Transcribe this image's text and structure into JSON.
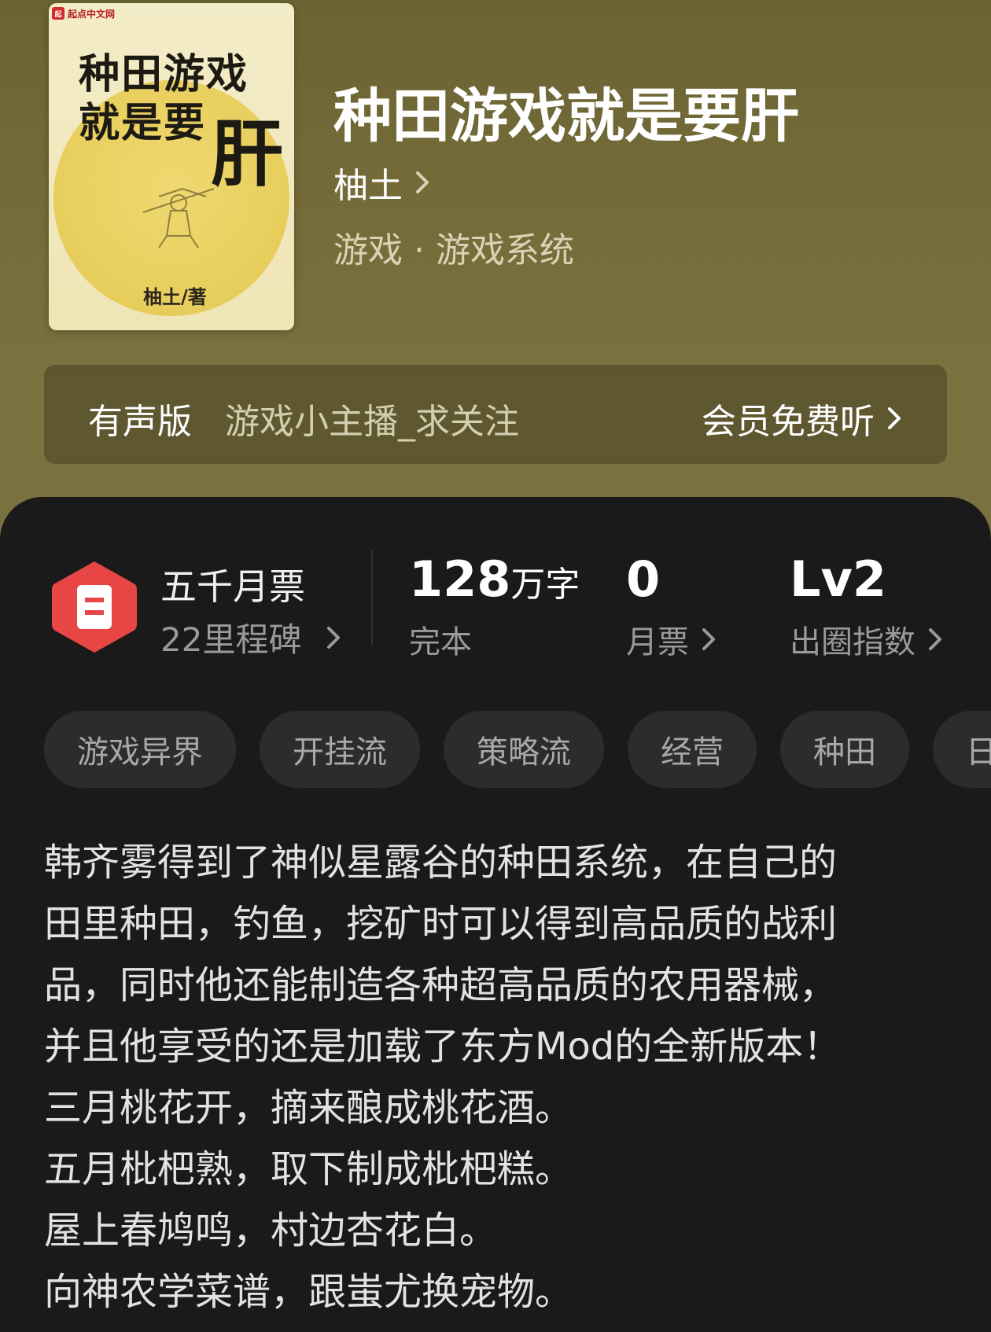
{
  "book": {
    "cover": {
      "publisher_logo": "起点中文网",
      "title_line1": "种田游戏",
      "title_line2": "就是要",
      "title_big": "肝",
      "author_credit": "柚土/著"
    },
    "title": "种田游戏就是要肝",
    "author": "柚土",
    "genre": "游戏 · 游戏系统"
  },
  "audio": {
    "label": "有声版",
    "narrator": "游戏小主播_求关注",
    "cta": "会员免费听"
  },
  "stats": {
    "badge_title": "五千月票",
    "badge_sub": "22里程碑",
    "words_value": "128",
    "words_unit": "万字",
    "words_label": "完本",
    "tickets_value": "0",
    "tickets_label": "月票",
    "circle_value": "Lv2",
    "circle_label": "出圈指数"
  },
  "tags": [
    "游戏异界",
    "开挂流",
    "策略流",
    "经营",
    "种田",
    "日"
  ],
  "description": [
    "韩齐雾得到了神似星露谷的种田系统，在自己的",
    "田里种田，钓鱼，挖矿时可以得到高品质的战利",
    "品，同时他还能制造各种超高品质的农用器械，",
    "并且他享受的还是加载了东方Mod的全新版本！",
    "三月桃花开，摘来酿成桃花酒。",
    "五月枇杷熟，取下制成枇杷糕。",
    "屋上春鸠鸣，村边杏花白。",
    "向神农学菜谱，跟蚩尤换宠物。"
  ],
  "colors": {
    "hero_bg": "#746b38",
    "panel_bg": "#1a1a1a",
    "badge_red": "#e84545",
    "tag_bg": "#2c2c2c"
  }
}
